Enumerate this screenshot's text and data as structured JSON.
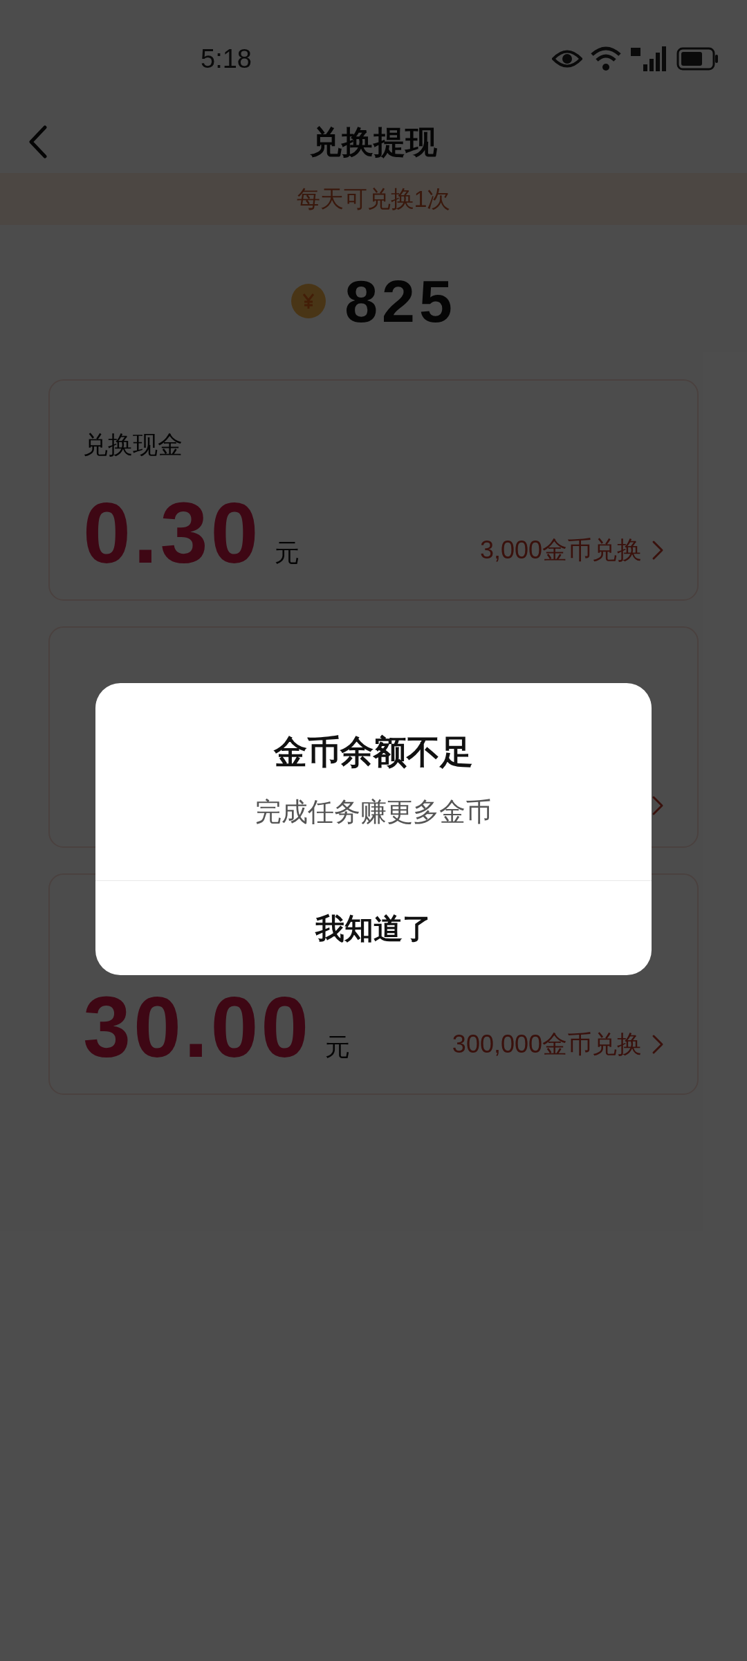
{
  "status_bar": {
    "time": "5:18"
  },
  "header": {
    "title": "兑换提现"
  },
  "notice": "每天可兑换1次",
  "balance": {
    "coins": "825"
  },
  "cards": [
    {
      "kind": "exchange",
      "title": "兑换现金",
      "amount": "0.30",
      "unit": "元",
      "exchange": "3,000金币兑换"
    },
    {
      "kind": "covered"
    },
    {
      "kind": "exchange",
      "amount": "30.00",
      "unit": "元",
      "exchange": "300,000金币兑换"
    }
  ],
  "dialog": {
    "title": "金币余额不足",
    "message": "完成任务赚更多金币",
    "button": "我知道了"
  }
}
